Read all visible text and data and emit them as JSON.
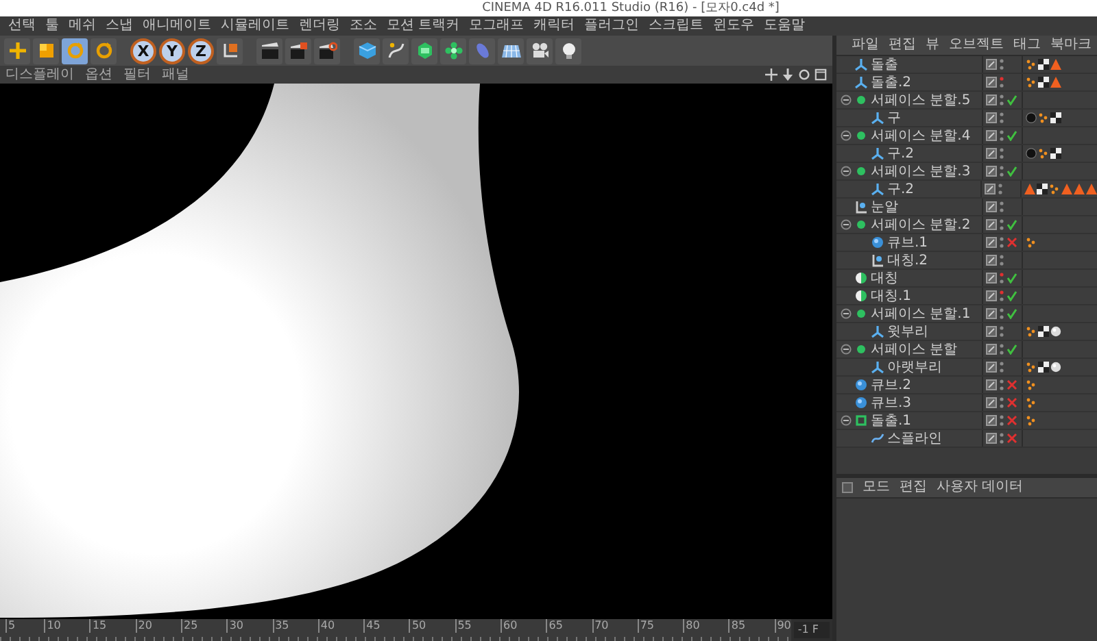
{
  "window": {
    "title": "CINEMA 4D R16.011 Studio (R16) - [모자0.c4d *]"
  },
  "menu": [
    "선택",
    "툴",
    "메쉬",
    "스냅",
    "애니메이트",
    "시뮬레이트",
    "렌더링",
    "조소",
    "모션 트랙커",
    "모그래프",
    "캐릭터",
    "플러그인",
    "스크립트",
    "윈도우",
    "도움말"
  ],
  "toolbar": [
    {
      "kind": "move",
      "selected": false
    },
    {
      "kind": "scale",
      "selected": false
    },
    {
      "kind": "rotate",
      "selected": true
    },
    {
      "kind": "rotate",
      "selected": false
    },
    {
      "kind": "axis",
      "label": "X",
      "selected": true
    },
    {
      "kind": "axis",
      "label": "Y",
      "selected": true
    },
    {
      "kind": "axis",
      "label": "Z",
      "selected": true
    },
    {
      "kind": "coords",
      "selected": false
    },
    {
      "kind": "clapper",
      "selected": false
    },
    {
      "kind": "clapper-edit",
      "selected": false
    },
    {
      "kind": "clapper-gear",
      "selected": false
    },
    {
      "kind": "cube",
      "selected": false
    },
    {
      "kind": "pen",
      "selected": false
    },
    {
      "kind": "gem",
      "selected": false
    },
    {
      "kind": "flower",
      "selected": false
    },
    {
      "kind": "capsule",
      "selected": false
    },
    {
      "kind": "floor",
      "selected": false
    },
    {
      "kind": "camera",
      "selected": false
    },
    {
      "kind": "bulb",
      "selected": false
    }
  ],
  "viewport": {
    "menu": [
      "디스플레이",
      "옵션",
      "필터",
      "패널"
    ]
  },
  "timeline": {
    "ticks": [
      "5",
      "10",
      "15",
      "20",
      "25",
      "30",
      "35",
      "40",
      "45",
      "50",
      "55",
      "60",
      "65",
      "70",
      "75",
      "80",
      "85",
      "90"
    ],
    "frame": "-1 F"
  },
  "object_manager": {
    "menu": [
      "파일",
      "편집",
      "뷰",
      "오브젝트",
      "태그",
      "북마크"
    ],
    "objects": [
      {
        "name": "돌출",
        "kind": "polygon",
        "hidden": false,
        "tags": [
          {
            "kind": "dots"
          },
          {
            "kind": "checker"
          },
          {
            "kind": "triangle"
          }
        ]
      },
      {
        "name": "돌출.2",
        "kind": "polygon",
        "hidden": true,
        "tags": [
          {
            "kind": "dots"
          },
          {
            "kind": "checker"
          },
          {
            "kind": "triangle"
          }
        ]
      },
      {
        "name": "서페이스 분할.5",
        "kind": "subdiv",
        "hidden": false,
        "enabled": true,
        "expanded": true,
        "children": [
          {
            "name": "구",
            "kind": "polygon",
            "hidden": false,
            "tags": [
              {
                "kind": "sphere-black"
              },
              {
                "kind": "dots"
              },
              {
                "kind": "checker"
              }
            ]
          }
        ]
      },
      {
        "name": "서페이스 분할.4",
        "kind": "subdiv",
        "hidden": false,
        "enabled": true,
        "expanded": true,
        "children": [
          {
            "name": "구.2",
            "kind": "polygon",
            "hidden": false,
            "tags": [
              {
                "kind": "sphere-black"
              },
              {
                "kind": "dots"
              },
              {
                "kind": "checker"
              }
            ]
          }
        ]
      },
      {
        "name": "서페이스 분할.3",
        "kind": "subdiv",
        "hidden": false,
        "enabled": true,
        "expanded": true,
        "children": [
          {
            "name": "구.2",
            "kind": "polygon",
            "hidden": false,
            "tags": [
              {
                "kind": "triangle"
              },
              {
                "kind": "checker"
              },
              {
                "kind": "dots"
              },
              {
                "kind": "triangle"
              },
              {
                "kind": "triangle"
              },
              {
                "kind": "triangle"
              }
            ]
          }
        ]
      },
      {
        "name": "눈알",
        "kind": "null",
        "hidden": false
      },
      {
        "name": "서페이스 분할.2",
        "kind": "subdiv",
        "hidden": false,
        "enabled": true,
        "expanded": true,
        "children": [
          {
            "name": "큐브.1",
            "kind": "cube",
            "hidden": false,
            "enabled": false,
            "tags": [
              {
                "kind": "dots"
              }
            ]
          },
          {
            "name": "대칭.2",
            "kind": "null",
            "hidden": false
          }
        ]
      },
      {
        "name": "대칭",
        "kind": "symmetry",
        "hidden": true,
        "enabled": true
      },
      {
        "name": "대칭.1",
        "kind": "symmetry",
        "hidden": true,
        "enabled": true
      },
      {
        "name": "서페이스 분할.1",
        "kind": "subdiv",
        "hidden": false,
        "enabled": true,
        "expanded": true,
        "children": [
          {
            "name": "윗부리",
            "kind": "polygon",
            "hidden": false,
            "tags": [
              {
                "kind": "dots"
              },
              {
                "kind": "checker"
              },
              {
                "kind": "sphere-white"
              }
            ]
          }
        ]
      },
      {
        "name": "서페이스 분할",
        "kind": "subdiv",
        "hidden": false,
        "enabled": true,
        "expanded": true,
        "children": [
          {
            "name": "아랫부리",
            "kind": "polygon",
            "hidden": false,
            "tags": [
              {
                "kind": "dots"
              },
              {
                "kind": "checker"
              },
              {
                "kind": "sphere-white"
              }
            ]
          }
        ]
      },
      {
        "name": "큐브.2",
        "kind": "cube",
        "hidden": false,
        "enabled": false,
        "tags": [
          {
            "kind": "dots"
          }
        ]
      },
      {
        "name": "큐브.3",
        "kind": "cube",
        "hidden": false,
        "enabled": false,
        "tags": [
          {
            "kind": "dots"
          }
        ]
      },
      {
        "name": "돌출.1",
        "kind": "extrude",
        "hidden": false,
        "enabled": false,
        "expanded": true,
        "tags": [
          {
            "kind": "dots"
          }
        ],
        "children": [
          {
            "name": "스플라인",
            "kind": "spline",
            "hidden": false,
            "enabled": false
          }
        ]
      }
    ]
  },
  "attribute_manager": {
    "menu": [
      "모드",
      "편집",
      "사용자 데이터"
    ]
  }
}
